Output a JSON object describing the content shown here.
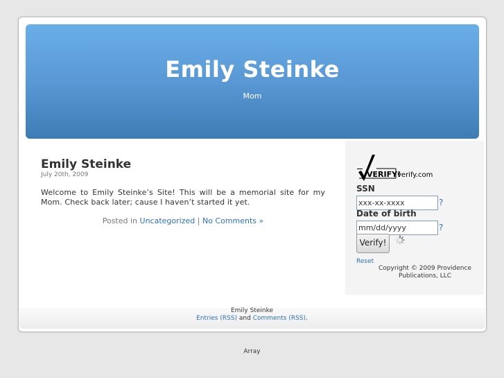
{
  "header": {
    "title": "Emily Steinke",
    "description": "Mom"
  },
  "post": {
    "title": "Emily Steinke",
    "date": "July 20th, 2009",
    "body": "Welcome to Emily Steinke’s Site! This will be a memorial site for my Mom. Check back later; cause I haven’t started it yet.",
    "meta_prefix": "Posted in",
    "category": "Uncategorized",
    "separator": "|",
    "comments": "No Comments »"
  },
  "widget": {
    "logo_text": "VERIFY!",
    "logo_domain": "verify.com",
    "ssn_label": "SSN",
    "ssn_value": "xxx-xx-xxxx",
    "dob_label": "Date of birth",
    "dob_value": "mm/dd/yyyy",
    "help": "?",
    "verify_button": "Verify!",
    "reset": "Reset",
    "copyright": "Copyright © 2009 Providence Publications, LLC"
  },
  "footer": {
    "site": "Emily Steinke",
    "entries": "Entries (RSS)",
    "and": "and",
    "comments": "Comments (RSS)",
    "end": "."
  },
  "below": "Array"
}
